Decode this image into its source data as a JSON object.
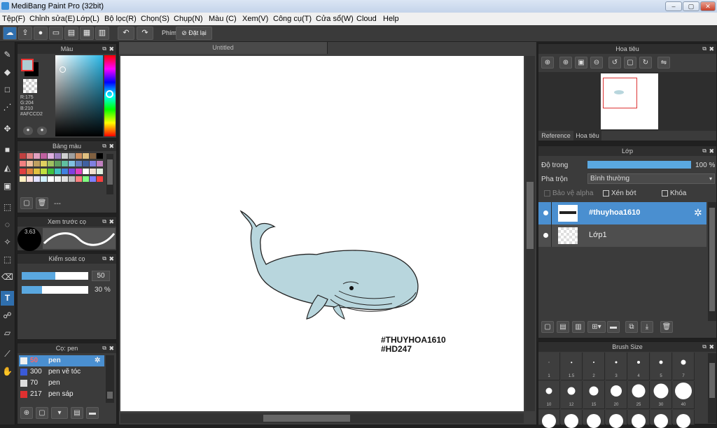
{
  "window": {
    "title": "MediBang Paint Pro (32bit)"
  },
  "menu": [
    "Tệp(F)",
    "Chỉnh sửa(E)",
    "Lớp(L)",
    "Bộ lọc(R)",
    "Chọn(S)",
    "Chụp(N)",
    "Màu (C)",
    "Xem(V)",
    "Công cụ(T)",
    "Cửa sổ(W)",
    "Cloud",
    "Help"
  ],
  "toolbar": {
    "shortcut_label": "Phím",
    "reset_label": "Đặt lại"
  },
  "color_panel": {
    "title": "Màu",
    "r": "R:175",
    "g": "G:204",
    "b": "B:210",
    "hex": "#AFCCD2",
    "current_color": "#AFCCD2"
  },
  "palette_panel": {
    "title": "Bảng màu",
    "footer": "---"
  },
  "brush_preview_panel": {
    "title": "Xem trước cọ",
    "size": "3.63"
  },
  "brush_control_panel": {
    "title": "Kiểm soát cọ",
    "size_value": "50",
    "size_level": 0.5,
    "opacity_value": "30 %",
    "opacity_level": 0.3
  },
  "brush_panel": {
    "title": "Cọ: pen",
    "items": [
      {
        "size": "50",
        "name": "pen",
        "color": "#f0f0f0"
      },
      {
        "size": "300",
        "name": "pen vẽ tóc",
        "color": "#3a5ad8"
      },
      {
        "size": "70",
        "name": "pen",
        "color": "#dddddd"
      },
      {
        "size": "217",
        "name": "pen sáp",
        "color": "#e03030"
      }
    ]
  },
  "document": {
    "tab": "Untitled",
    "hashtag1": "#THUYHOA1610",
    "hashtag2": "#HD247"
  },
  "navigator_panel": {
    "title": "Hoa tiêu",
    "tab_reference": "Reference",
    "tab_navigator": "Hoa tiêu"
  },
  "layer_panel": {
    "title": "Lớp",
    "opacity_label": "Độ trong",
    "opacity_value": "100 %",
    "opacity_level": 1.0,
    "blend_label": "Pha trộn",
    "blend_value": "Bình thường",
    "protect_alpha": "Bảo vệ alpha",
    "clipping": "Xén bớt",
    "lock": "Khóa",
    "layers": [
      {
        "name": "#thuyhoa1610",
        "selected": true
      },
      {
        "name": "Lớp1",
        "selected": false
      }
    ]
  },
  "brush_size_panel": {
    "title": "Brush Size",
    "row1": [
      "1",
      "1.5",
      "2",
      "3",
      "4",
      "5",
      "7"
    ],
    "row2": [
      "10",
      "12",
      "15",
      "20",
      "25",
      "30",
      "40"
    ]
  }
}
